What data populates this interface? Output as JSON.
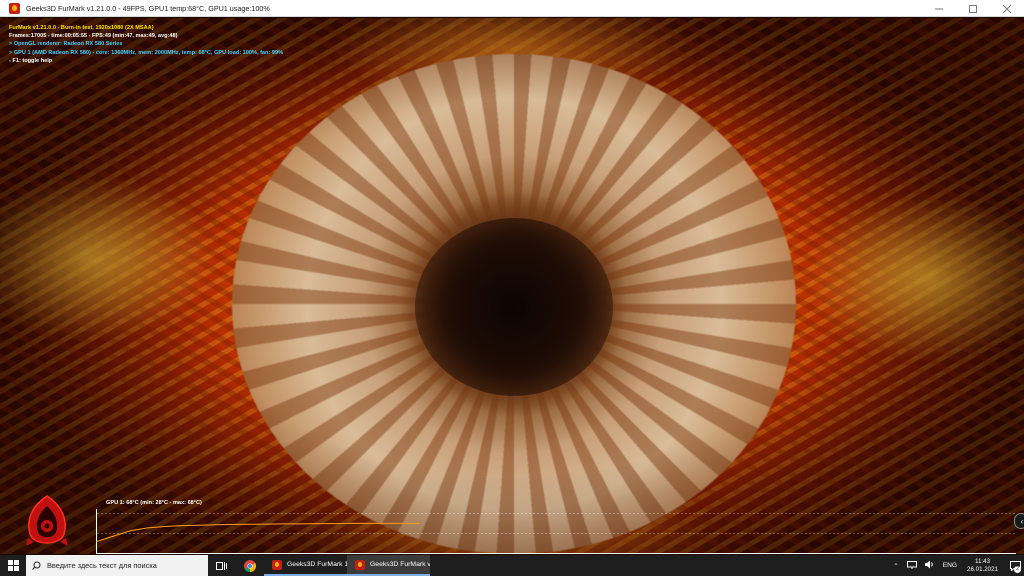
{
  "window": {
    "title": "Geeks3D FurMark v1.21.0.0 - 49FPS, GPU1 temp:68°C, GPU1 usage:100%",
    "controls": {
      "minimize_icon": "minimize-icon",
      "maximize_icon": "maximize-icon",
      "close_icon": "close-icon"
    }
  },
  "overlay": {
    "line1": "FurMark v1.21.0.0 - Burn-in test, 1920x1080 (2X MSAA)",
    "line2": "Frames:17005 - time:00:05:55 - FPS:49 (min:47, max:49, avg:48)",
    "line3": "> OpenGL renderer: Radeon RX 580 Series",
    "line4": "> GPU 1 (AMD Radeon RX 580) - core: 1360MHz, mem: 2000MHz, temp: 68°C, GPU load: 100%, fan: 99%",
    "line5": "- F1: toggle help"
  },
  "graph": {
    "label": "GPU 1: 68°C (min: 28°C - max: 68°C)"
  },
  "chart_data": {
    "type": "line",
    "series": [
      {
        "name": "GPU 1",
        "values": [
          28,
          40,
          52,
          58,
          61,
          63,
          64,
          65,
          65.5,
          66,
          66.5,
          67,
          67,
          67.5,
          67.5,
          68,
          68,
          68,
          68,
          68
        ]
      }
    ],
    "ylim": [
      0,
      100
    ],
    "grid": true
  },
  "taskbar": {
    "search_placeholder": "Введите здесь текст для поиска",
    "apps": [
      {
        "label": "Geeks3D FurMark 1...",
        "active": false
      },
      {
        "label": "Geeks3D FurMark v...",
        "active": true
      }
    ],
    "tray": {
      "language": "ENG",
      "time": "11:43",
      "date": "26.01.2021",
      "notifications_count": "2"
    }
  },
  "colors": {
    "overlay_title": "#ffe600",
    "overlay_cyan": "#3fd2ff",
    "graph_line": "#ffa01e",
    "taskbar_bg": "#1e1e1e"
  }
}
